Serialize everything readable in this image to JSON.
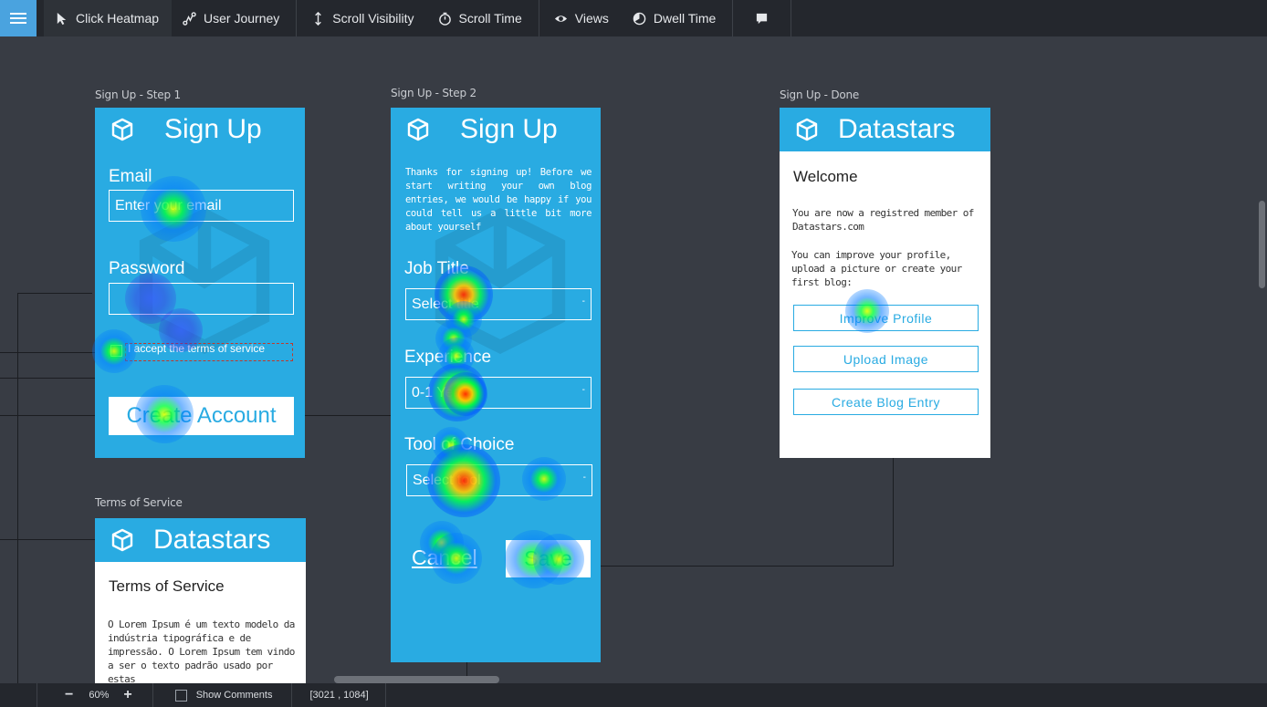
{
  "toolbar": {
    "items": [
      {
        "label": "Click Heatmap",
        "icon": "cursor-icon"
      },
      {
        "label": "User Journey",
        "icon": "journey-icon"
      },
      {
        "label": "Scroll Visibility",
        "icon": "scroll-icon"
      },
      {
        "label": "Scroll Time",
        "icon": "stopwatch-icon"
      },
      {
        "label": "Views",
        "icon": "eye-icon"
      },
      {
        "label": "Dwell Time",
        "icon": "dwell-icon"
      },
      {
        "label": "",
        "icon": "comment-icon"
      }
    ],
    "accent": "#4aa3df"
  },
  "screens": {
    "step1": {
      "caption": "Sign Up - Step 1",
      "title": "Sign Up",
      "email_label": "Email",
      "email_placeholder": "Enter your email",
      "password_label": "Password",
      "terms_text": "I accept the terms of service",
      "create_button": "Create Account"
    },
    "step2": {
      "caption": "Sign Up - Step 2",
      "title": "Sign Up",
      "intro": "Thanks for signing up! Before we start writing your own blog entries, we would be happy if you could tell us a little bit more about yourself",
      "job_label": "Job Title",
      "job_value": "Select title",
      "experience_label": "Experience",
      "experience_value": "0-1 Years",
      "tool_label": "Tool of Choice",
      "tool_value": "Select tool",
      "cancel": "Cancel",
      "save": "Save"
    },
    "done": {
      "caption": "Sign Up - Done",
      "title": "Datastars",
      "welcome": "Welcome",
      "member_text": "You are now a registred member of Datastars.com",
      "improve_text": "You can improve your profile, upload a picture or create your first blog:",
      "btn_profile": "Improve Profile",
      "btn_upload": "Upload Image",
      "btn_blog": "Create Blog Entry"
    },
    "terms": {
      "caption": "Terms of Service",
      "title": "Datastars",
      "heading": "Terms of Service",
      "body": "O Lorem Ipsum é um texto modelo da indústria tipográfica e de impressão. O Lorem Ipsum tem vindo a ser o texto padrão usado por estas"
    }
  },
  "status": {
    "zoom": "60%",
    "minus": "−",
    "plus": "+",
    "show_comments": "Show Comments",
    "coords": "[3021 , 1084]"
  },
  "colors": {
    "screen_blue": "#29abe2",
    "canvas": "#383c44",
    "toolbar": "#24272d"
  }
}
